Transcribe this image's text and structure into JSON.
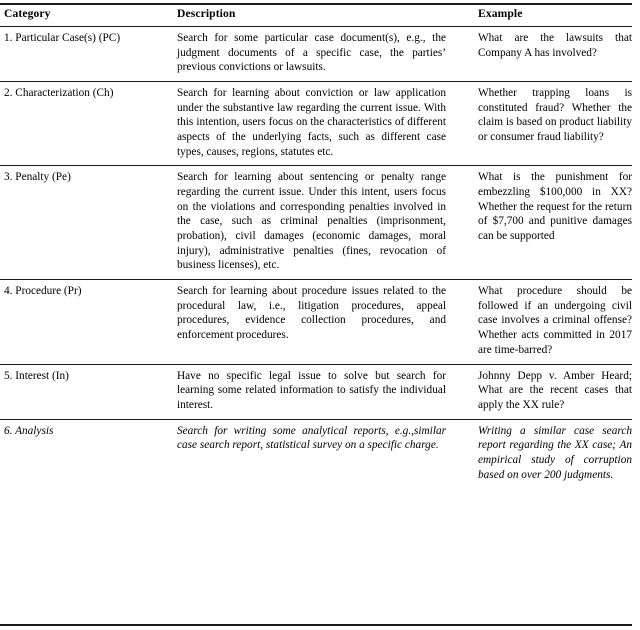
{
  "table": {
    "headers": {
      "category": "Category",
      "description": "Description",
      "example": "Example"
    },
    "rows": [
      {
        "category": "1. Particular Case(s) (PC)",
        "description": "Search for some particular case document(s), e.g., the judgment documents of a specific case, the parties’ previous convictions or lawsuits.",
        "example": "What are the lawsuits that Company A has involved?",
        "italic": false
      },
      {
        "category": "2. Characterization (Ch)",
        "description": "Search for learning about conviction or law application under the substantive law regarding the current issue. With this intention, users focus on the characteristics of different aspects of the underlying facts, such as different case types, causes, regions, statutes etc.",
        "example": "Whether trapping loans is constituted fraud? Whether the claim is based on product liability or consumer fraud liability?",
        "italic": false
      },
      {
        "category": "3. Penalty (Pe)",
        "description": "Search for learning about sentencing or penalty range regarding the current issue. Under this intent, users focus on the violations and corresponding penalties involved in the case, such as criminal penalties (imprisonment, probation), civil damages (economic damages, moral injury), administrative penalties (fines, revocation of business licenses), etc.",
        "example": "What is the punishment for embezzling $100,000 in XX? Whether the request for the return of $7,700 and punitive damages can be supported",
        "italic": false
      },
      {
        "category": "4. Procedure (Pr)",
        "description": "Search for learning about procedure issues related to the procedural law, i.e., litigation procedures, appeal procedures, evidence collection procedures, and enforcement procedures.",
        "example": "What procedure should be followed if an undergoing civil case involves a criminal offense? Whether acts committed in 2017 are time-barred?",
        "italic": false
      },
      {
        "category": "5. Interest (In)",
        "description": "Have no specific legal issue to solve but search for learning some related information to satisfy the individual interest.",
        "example": "Johnny Depp v. Amber Heard; What are the recent cases that apply the XX rule?",
        "italic": false
      },
      {
        "category": "6. Analysis",
        "description": "Search for writing some analytical reports, e.g.,similar case search report, statistical survey on a specific charge.",
        "example": "Writing a similar case search report regarding the XX case; An empirical study of corruption based on over 200 judgments.",
        "italic": true
      }
    ]
  },
  "style": {
    "rule_color": "#1a1a1a",
    "text_color": "#000000",
    "background": "#ffffff"
  }
}
